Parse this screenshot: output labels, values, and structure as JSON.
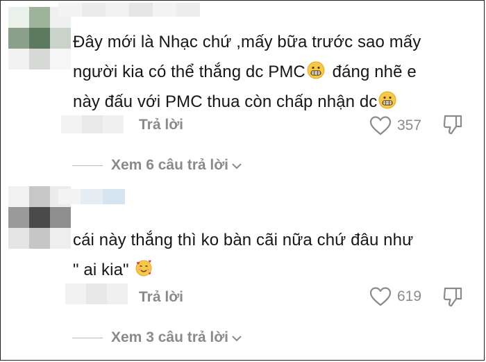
{
  "comments": [
    {
      "text_lines": [
        "Đây mới là Nhạc chứ ,mấy bữa trước sao mấy",
        "người kia có thể thắng dc PMC",
        "đáng nhẽ e",
        "này đấu với PMC thua còn chấp nhận dc"
      ],
      "emoji": "grimacing-face",
      "reply_label": "Trả lời",
      "likes": "357",
      "view_replies": "Xem 6 câu trả lời"
    },
    {
      "text_lines": [
        "cái này thắng thì ko bàn cãi nữa chứ đâu như",
        "\" ai kia\""
      ],
      "emoji": "smiling-face-with-hearts",
      "reply_label": "Trả lời",
      "likes": "619",
      "view_replies": "Xem 3 câu trả lời"
    }
  ],
  "icons": {
    "like": "heart-outline",
    "dislike": "thumbs-down-outline",
    "expand": "chevron-down"
  },
  "colors": {
    "text": "#161616",
    "secondary": "#8a8a8a",
    "divider": "#b8b8b8",
    "emoji_face": "#f7c948"
  }
}
